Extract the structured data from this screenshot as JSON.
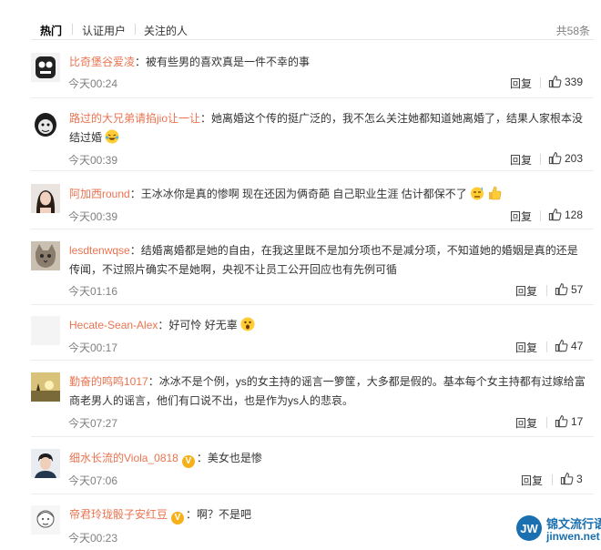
{
  "tabs": [
    "热门",
    "认证用户",
    "关注的人"
  ],
  "total": "共58条",
  "reply_label": "回复",
  "comments": [
    {
      "user": "比奇堡谷爱凌",
      "sep": "：",
      "text": "被有些男的喜欢真是一件不幸的事",
      "time": "今天00:24",
      "likes": "339",
      "avatar_icon": "cartoon-avatar"
    },
    {
      "user": "路过的大兄弟请掐jio让一让",
      "sep": "：",
      "text": "她离婚这个传的挺广泛的，我不怎么关注她都知道她离婚了，结果人家根本没",
      "text2": "结过婚",
      "emoji": "laugh-cry-emoji",
      "time": "今天00:39",
      "likes": "203",
      "avatar_icon": "meme-avatar"
    },
    {
      "user": "阿加西round",
      "sep": "：",
      "text": "王冰冰你是真的惨啊 现在还因为俩奇葩 自己职业生涯 估计都保不了",
      "emoji": "sweat-emoji",
      "emoji2": "thumbs-up-emoji",
      "time": "今天00:39",
      "likes": "128",
      "avatar_icon": "girl-avatar"
    },
    {
      "user": "lesdtenwqse",
      "sep": "：",
      "text": "结婚离婚都是她的自由，在我这里既不是加分项也不是减分项，不知道她的婚姻是真的还是",
      "text2": "传闻，不过照片确实不是她啊，央视不让员工公开回应也有先例可循",
      "time": "今天01:16",
      "likes": "57",
      "avatar_icon": "cat-avatar"
    },
    {
      "user": "Hecate-Sean-Alex",
      "sep": "：",
      "text": "好可怜 好无辜",
      "emoji": "surprised-emoji",
      "time": "今天00:17",
      "likes": "47",
      "avatar_icon": "blank-avatar"
    },
    {
      "user": "勤奋的鸣鸣1017",
      "sep": "：",
      "text": "冰冰不是个例，ys的女主持的谣言一箩筐，大多都是假的。基本每个女主持都有过嫁给富",
      "text2": "商老男人的谣言，他们有口说不出，也是作为ys人的悲哀。",
      "time": "今天07:27",
      "likes": "17",
      "avatar_icon": "sunset-avatar"
    },
    {
      "user": "细水长流的Viola_0818",
      "verified": "V",
      "sep": "：",
      "text": "美女也是惨",
      "time": "今天07:06",
      "likes": "3",
      "avatar_icon": "man-avatar"
    },
    {
      "user": "帝君玲珑骰子安红豆",
      "verified": "V",
      "sep": "：",
      "text": "啊？不是吧",
      "time": "今天00:23",
      "likes": "",
      "avatar_icon": "sketch-avatar"
    }
  ],
  "watermark": {
    "title": "锦文流行语",
    "url": "jinwen.net",
    "logo": "JW"
  }
}
